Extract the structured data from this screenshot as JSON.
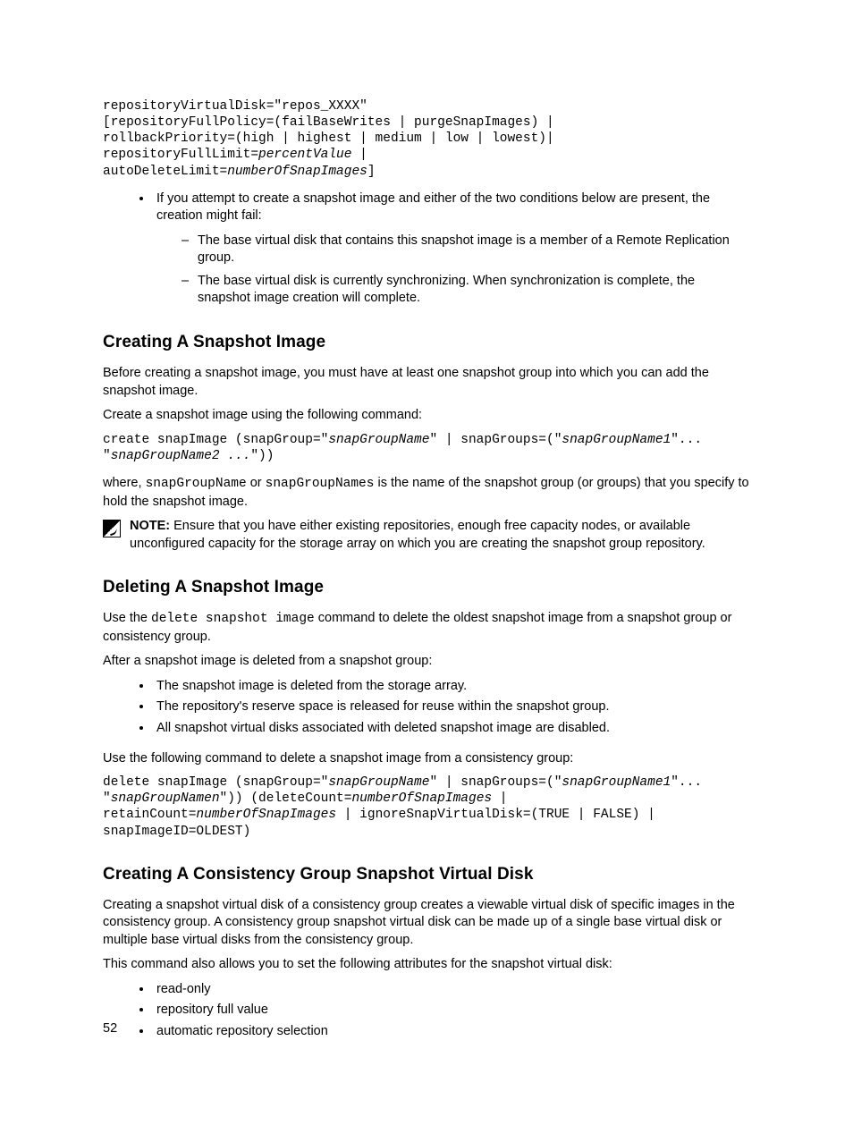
{
  "code1": {
    "line1a": "repositoryVirtualDisk=\"repos_XXXX\"",
    "line2a": "[repositoryFullPolicy=(failBaseWrites | purgeSnapImages) |",
    "line3a": "rollbackPriority=(high | highest | medium | low | lowest)|",
    "line4a": "repositoryFullLimit=",
    "line4b": "percentValue",
    "line4c": " |",
    "line5a": "autoDeleteLimit=",
    "line5b": "numberOfSnapImages",
    "line5c": "]"
  },
  "bullets1": {
    "main": "If you attempt to create a snapshot image and either of the two conditions below are present, the creation might fail:",
    "sub1": "The base virtual disk that contains this snapshot image is a member of a Remote Replication group.",
    "sub2": "The base virtual disk is currently synchronizing. When synchronization is complete, the snapshot image creation will complete."
  },
  "sec_create": {
    "heading": "Creating A Snapshot Image",
    "p1": "Before creating a snapshot image, you must have at least one snapshot group into which you can add the snapshot image.",
    "p2": "Create a snapshot image using the following command:",
    "code_a": "create snapImage (snapGroup=\"",
    "code_b": "snapGroupName",
    "code_c": "\" | snapGroups=(\"",
    "code_d": "snapGroupName1",
    "code_e": "\"...",
    "code_f": "\"",
    "code_g": "snapGroupName2 ...",
    "code_h": "\"))",
    "p3a": "where, ",
    "p3b": "snapGroupName",
    "p3c": " or ",
    "p3d": "snapGroupNames",
    "p3e": " is the name of the snapshot group (or groups) that you specify to hold the snapshot image.",
    "note_label": "NOTE: ",
    "note_text": "Ensure that you have either existing repositories, enough free capacity nodes, or available unconfigured capacity for the storage array on which you are creating the snapshot group repository."
  },
  "sec_delete": {
    "heading": "Deleting A Snapshot Image",
    "p1a": "Use the ",
    "p1b": "delete snapshot image",
    "p1c": " command to delete the oldest snapshot image from a snapshot group or consistency group.",
    "p2": "After a snapshot image is deleted from a snapshot group:",
    "b1": "The snapshot image is deleted from the storage array.",
    "b2": "The repository's reserve space is released for reuse within the snapshot group.",
    "b3": "All snapshot virtual disks associated with deleted snapshot image are disabled.",
    "p3": "Use the following command to delete a snapshot image from a consistency group:",
    "code_a": "delete snapImage (snapGroup=\"",
    "code_b": "snapGroupName",
    "code_c": "\" | snapGroups=(\"",
    "code_d": "snapGroupName1",
    "code_e": "\"...",
    "code_f": "\"",
    "code_g": "snapGroupNamen",
    "code_h": "\")) (deleteCount=",
    "code_i": "numberOfSnapImages",
    "code_j": " |",
    "code_k": "retainCount=",
    "code_l": "numberOfSnapImages",
    "code_m": " | ignoreSnapVirtualDisk=(TRUE | FALSE) |",
    "code_n": "snapImageID=OLDEST)"
  },
  "sec_cg": {
    "heading": "Creating A Consistency Group Snapshot Virtual Disk",
    "p1": "Creating a snapshot virtual disk of a consistency group creates a viewable virtual disk of specific images in the consistency group. A consistency group snapshot virtual disk can be made up of a single base virtual disk or multiple base virtual disks from the consistency group.",
    "p2": "This command also allows you to set the following attributes for the snapshot virtual disk:",
    "b1": "read-only",
    "b2": "repository full value",
    "b3": "automatic repository selection"
  },
  "page_number": "52"
}
